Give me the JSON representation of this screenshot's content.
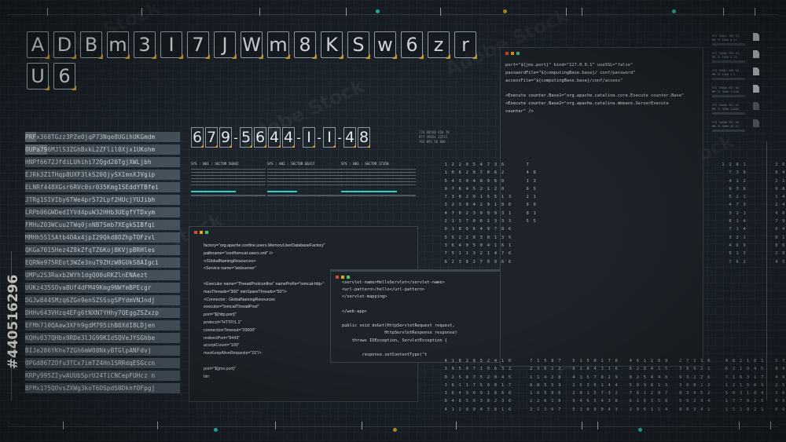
{
  "hero_tiles": [
    "A",
    "D",
    "B",
    "m",
    "3",
    "I",
    "7",
    "J",
    "W",
    "m",
    "8",
    "K",
    "S",
    "w",
    "6",
    "z",
    "r",
    "U",
    "6"
  ],
  "readout": {
    "groups": [
      [
        "6",
        "7",
        "9"
      ],
      [
        "5",
        "6",
        "4",
        "4"
      ],
      [
        "I"
      ],
      [
        "I"
      ],
      [
        "4",
        "8"
      ]
    ],
    "meta": [
      "776 00540  410 70",
      "877 49654 22515",
      "765 091 56  800"
    ]
  },
  "code_strips": [
    {
      "hl": "PRF",
      "rest": "x368TGzz3PZe0jqP73Nqe8UGihUKGmdm"
    },
    {
      "hl": "OUPa79",
      "rest": "6MJlS3ZGhBxkL2ZFlil0Xjx1UKohm"
    },
    {
      "hl": "",
      "rest": "HNPf6672JfdiLUhihi72Qgd20TgjXWLjbh"
    },
    {
      "hl": "",
      "rest": "EJRk3Z1THqp8UXF3lkS20QjySXImnXJVgip"
    },
    {
      "hl": "",
      "rest": "ELNRf448XGsr6RVc0sr035Kmg1SEddYTBfei"
    },
    {
      "hl": "",
      "rest": "JTRg1S1VIby6TWe4pr572Lpf2HUcjYUJibh"
    },
    {
      "hl": "",
      "rest": "LRPb06GWDedIYVd4puW32HHb3UEgfYTDxym"
    },
    {
      "hl": "",
      "rest": "FMHuZ03WCuu2TWq0jnNB7Smb7XEgkSIBfqi"
    },
    {
      "hl": "",
      "rest": "MMHh5515Atb4OAx4jpI29Qkd8OZhpTOFzvl"
    },
    {
      "hl": "",
      "rest": "QKGa7015Hez4Z8kZfqTZ6Koj8KVjpBRHles"
    },
    {
      "hl": "",
      "rest": "EQRNe975REot3WZe3nuT9ZHzW8GUkS8AIgci"
    },
    {
      "hl": "",
      "rest": "UMPu2S3Raxb2WYh1dgQ00uRKZlnENAezt"
    },
    {
      "hl": "",
      "rest": "UUKz435SOvaBUf4dFM49Kmg9NWfmBPEcgr"
    },
    {
      "hl": "",
      "rest": "DGJw844SMzq6ZGn9enSZSSsgSPYdmVNJndj"
    },
    {
      "hl": "",
      "rest": "DHHv643VHzq4EFg6tNXN7YHhy7QEggZSZxzp"
    },
    {
      "hl": "",
      "rest": "EFMh710QAaw3XFh9gdM795ihB0XdI8LDjen"
    },
    {
      "hl": "",
      "rest": "KQHv037QHbx9RDe3lJG99KIdSQVeJYSGhbe"
    },
    {
      "hl": "",
      "rest": "BIJe286YKhv7ZGh6mW08NkyBTGlpANFdvj"
    },
    {
      "hl": "",
      "rest": "OPGd867ZOfu3TCx7imTZ4Hn1SRRdqESGccn"
    },
    {
      "hl": "",
      "rest": "KRPy995ZIywAUUb5prU24TiCNCepFUHcz n"
    },
    {
      "hl": "",
      "rest": "BFMx175QOvsZXWg3koT6OSpdS0DknfOFpgj"
    }
  ],
  "side_label": "#440516296",
  "sectors": [
    {
      "label": "SYS : 001 : SECTOR 56042",
      "tag": "SYS"
    },
    {
      "label": "SYS : 002 : SECTOR 66317",
      "tag": "SYS"
    },
    {
      "label": "SYS : 003 : SECTOR 17350",
      "tag": "SYS"
    }
  ],
  "win_xml": {
    "lines": [
      "factory=\"org.apache.confine.users.MemoryUserDatabaseFactory\"",
      "pathname=\"conf/tomcat-users.xml\" />",
      "</GlobalNamingResources>",
      "<Service name=\"webserver\"",
      "",
      "<Executor name=\"ThreadPoolconfine\" namePrefix=\"tomcat-http-\"",
      "maxThreads=\"300\" minSpareThreads=\"50\"/>",
      "<Connector : GlobalNamingResources",
      "executor=\"tomcatThreadPool\"",
      "port=\"${http.port}\"",
      "protocol=\"HTTP/1.1\"",
      "connectionTimeout=\"20000\"",
      "redirectPort=\"8443\"",
      "acceptCount=\"100\"",
      "maxKeepAliveRequests=\"15\"/>",
      "",
      "port=\"${jmx.port}\"",
      "bin"
    ]
  },
  "win_java": {
    "lines": [
      "<servlet-name>HelloServlet</servlet-name>",
      "<url-pattern>/hello</url-pattern>",
      "</servlet-mapping>",
      "",
      "</web-app>",
      "",
      "public void doGet(HttpServletRequest request,",
      "                 HttpServletResponse response)",
      "    throws IOException, ServletException {",
      "",
      "        response.setContentType(\"t"
    ]
  },
  "win_top": {
    "lines": [
      "port=\"${jmx.port}\" bind=\"127.0.0.1\" useSSL=\"false\"",
      "passwordFile=\"${computingBase.base}/ conf/password\"",
      "accessFile=\"${computingBase.base}/conf/access\"",
      "",
      "<Execute counter.Base1=\"org.apache.catalina.core.Execute counter.Base\"",
      "<Execute counter.Base2=\"org.apache.catalina.mbeans.ServerExecute",
      "counter\" />"
    ]
  },
  "num_grid": [
    "   1 2 2 0 5 4 7 3 6      7                                                      1 2 8 1        3 6 7 9 1",
    "   1 0 6 2 8 7 0 6 2      4 8                                                      7 3 9        8 4 1 2 2",
    "   5 4 3 0 4 8 9 6 0      1 3                                                      4 1 2        2 1 7 4 6",
    "   9 7 6 4 5 2 1 2 0      6 5                                                      9 3 6        9 8 2 1 4",
    "   7 3 0 2 0 1 5 5 1 3    2 1                                                      5 2 1        1 4 9 8 2",
    "   3 2 3 8 4 2 9 1 8 0    6 0                                                      4 7 3        2 4 0 6 0",
    "   4 7 0 2 3 0 0 9 3 1    8 1                                                      3 2 1        4 0 8 1 7",
    "   2 1 3 7 0 6 1 3 3 3    5 5                                                      8 1 4        7 9 2 5 1",
    "   0 1 8 6 6 4 9 7 8 6                                                             7 1 4        6 4 2 8 3",
    "   5 5 2 2 8 3 0 1 3 5                                                             3 2 1        8 1 7 6 0",
    "   3 6 4 0 5 0 4 1 6 1                                                             4 6 9        8 6 8 2 8",
    "   7 5 1 1 3 2 1 4 7 6                                                             9 1 3        2 8 4 1 0",
    "   6 2 3 8 2 7 0 0 6 6                                                             7 6 2        4 5 1 7 2"
  ],
  "num_grid_low": [
    "   4 1 8 2 8 5 2 4 1 0     7 1 5 8 7   5 1 5 0 1 7 8   4 6 1 2 8 9   2 7 1 1 8    4 8 2 1 8 1   5 7 2 8 4",
    "   3 9 5 0 7 1 0 6 3 2     2 3 6 1 2   8 2 8 4 3 1 6   6 2 8 4 1 5   3 8 9 2 1    6 2 1 9 4 5   8 4 6 1 2",
    "   0 2 5 8 7 5 2 0 4 5     1 1 4 2 8   4 1 5 7 8 2 9   8 2 5 4 4 8   9 3 2 2 6    7 1 6 3 1 7   4 9 1 3 8",
    "   3 6 1 1 7 5 0 0 1 7     6 8 5 5 3   2 5 3 6 1 4 4   5 0 9 8 1 3   3 0 8 1 2    1 2 1 5 8 9   2 5 6 1 2",
    "   3 6 4 9 0 9 1 8 6 0     1 6 5 8 6   2 0 1 5 7 3 2   7 6 1 2 8 7   8 3 9 5 2    5 0 3 1 8 4   3 6 8 1 3",
    "   8 4 8 5 0 3 8 2 3 6     2 2 6 1 8   9 4 6 5 4 3 8   6 1 6 3 5 8   5 9 2 3 4    1 7 7 8 2 9   6 0 3 1 2",
    "   4 1 2 8 0 4 5 8 1 6     2 1 3 0 7   5 1 6 8 0 4 3   2 9 6 1 1 4   8 8 3 4 1    1 5 2 9 2 1   6 0 3 7 0"
  ],
  "files": [
    {
      "t1": "STI  70001  780 55",
      "t2": "MM  7S  1000  0.11"
    },
    {
      "t1": "STI  70000  990 40",
      "t2": "MM  7S  1000  6.10"
    },
    {
      "t1": "STI  70001  530 58",
      "t2": "MM  7S  1000  1.5"
    },
    {
      "t1": "STI  70008  651 86",
      "t2": "MM  7S  3000  11100"
    },
    {
      "t1": "STI  70000  981 05",
      "t2": "MM  7S  3000  11000"
    },
    {
      "t1": "STI  70008  591 09",
      "t2": "MM  7S  3000  54.27"
    }
  ],
  "watermark": "Adobe Stock",
  "colors": {
    "accent": "#2fd1c6",
    "orange": "#d9a52a",
    "red": "#d9463b",
    "green": "#48c36a"
  }
}
